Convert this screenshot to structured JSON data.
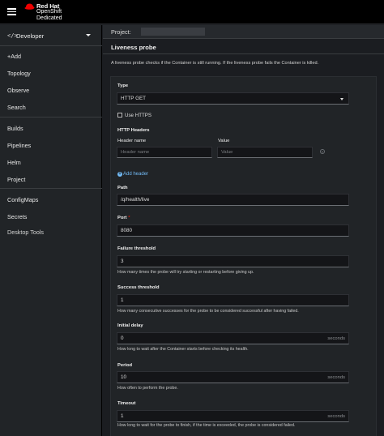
{
  "masthead": {
    "brand_line1": "Red Hat",
    "brand_line2": "OpenShift",
    "brand_line3": "Dedicated",
    "brand_color": "#ee0000"
  },
  "sidebar": {
    "perspective_icon": "</>",
    "perspective": "Developer",
    "items": {
      "add": "+Add",
      "topology": "Topology",
      "observe": "Observe",
      "search": "Search",
      "builds": "Builds",
      "pipelines": "Pipelines",
      "helm": "Helm",
      "project": "Project",
      "configmaps": "ConfigMaps",
      "secrets": "Secrets",
      "desktop_tools": "Desktop Tools"
    }
  },
  "project_bar": {
    "label": "Project: "
  },
  "probe": {
    "title": "Liveness probe",
    "description": "A liveness probe checks if the Container is still running. If the liveness probe fails the Container is killed.",
    "type": {
      "label": "Type",
      "value": "HTTP GET"
    },
    "use_https": {
      "label": "Use HTTPS",
      "checked": false
    },
    "headers": {
      "label": "HTTP Headers",
      "name_label": "Header name",
      "value_label": "Value",
      "name_placeholder": "Header name",
      "value_placeholder": "Value",
      "add_label": "Add header"
    },
    "path": {
      "label": "Path",
      "value": "/q/health/live"
    },
    "port": {
      "label": "Port",
      "required_mark": "*",
      "value": "8080"
    },
    "failure_threshold": {
      "label": "Failure threshold",
      "value": "3",
      "help": "How many times the probe will try starting or restarting before giving up."
    },
    "success_threshold": {
      "label": "Success threshold",
      "value": "1",
      "help": "How many consecutive successes for the probe to be considered successful after having failed."
    },
    "initial_delay": {
      "label": "Initial delay",
      "value": "0",
      "suffix": "seconds",
      "help": "How long to wait after the Container starts before checking its health."
    },
    "period": {
      "label": "Period",
      "value": "10",
      "suffix": "seconds",
      "help": "How often to perform the probe."
    },
    "timeout": {
      "label": "Timeout",
      "value": "1",
      "suffix": "seconds",
      "help": "How long to wait for the probe to finish, if the time is exceeded, the probe is considered failed."
    }
  }
}
